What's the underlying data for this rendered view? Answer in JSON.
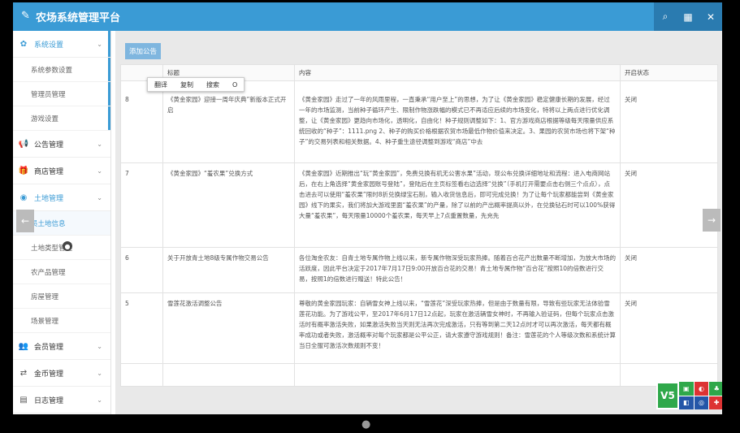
{
  "app": {
    "logo": "✎",
    "title": "农场系统管理平台"
  },
  "topbar": {
    "search_icon": "⌕",
    "grid_icon": "▦",
    "close_icon": "✕"
  },
  "sidebar": {
    "system_settings": "系统设置",
    "system_sub": [
      "系统参数设置",
      "管理员管理",
      "游戏设置"
    ],
    "announcement": "公告管理",
    "shop": "商店管理",
    "land": "土地管理",
    "land_sub": [
      "员土地信息",
      "土地类型管理",
      "农产品管理",
      "房屋管理",
      "场景管理"
    ],
    "member": "会员管理",
    "coin": "金币管理",
    "log": "日志管理"
  },
  "content": {
    "add_button": "添加公告",
    "columns": [
      "",
      "标题",
      "内容",
      "开启状态"
    ],
    "rows": [
      {
        "id": "8",
        "title": "《黄金家园》迎接一周年庆典”新版本正式开启",
        "content": "《黄金家园》走过了一年的风雨里程，一直秉承“用户至上”的思想，为了让《黄金家园》稳定健康长期的发展，经过一年的市场监测，当前种子循环产生、限制作物涨跌幅的模式已不再适应后续的市场变化，特将以上两点进行优化调整，让《黄金家园》更趋向市场化，透明化，自由化！种子规则调整如下：1、官方游戏商店根据等级每天限量供应系统回收的“种子”：1111.png 2、种子的购买价格根据农贸市场最低作物价值来决定。3、果园的农贸市场也将下架“种子”的交易列表和相关数据。4、种子重生途径调整到游戏“商店”中去",
        "status": "关闭"
      },
      {
        "id": "7",
        "title": "《黄金家园》“羞农果”兑换方式",
        "content": "《黄金家园》近期推出“玩“黄金家园”，免费兑换有机无公害水果”活动，现公布兑换详细地址和流程：进入电商网站后，在右上角选择“黄金家园账号登陆”，登陆后在主页标签看右边选择“兑换”（手机打开需要点击右侧三个点点），点击进去可以使用“羞农果”限时8折兑换绿宝石制，输入收货信息后，即可完成兑换！为了让每个玩家都能尝到《黄金家园》线下的果实，我们将加大游戏里面“羞农果”的产量，除了以前的产出概率提高以外，在兑换钻石时可以100%获得大量“羞农果”，每天限量10000个羞农果，每天早上7点重置数量，先充先",
        "status": "关闭"
      },
      {
        "id": "6",
        "title": "关于开放青土地8级专属作物交易公告",
        "content": "各位淘金农友：自青土地专属作物上线以来，新专属作物深受玩家热捧。随着百合花产出数量不断增加，为放大市场的活跃度，因此平台决定于2017年7月17日9:00开放百合花的交易！青土地专属作物“百合花”按照10的倍数进行交易，按照1的倍数进行赠送！特此公告！",
        "status": "关闭"
      },
      {
        "id": "5",
        "title": "雪莲花激活调整公告",
        "content": "尊敬的黄金家园玩家：自辆雪女神上线以来，“雪莲花”深受玩家热捧，但是由于数量有限，导致有些玩家无法体验雪莲花功能。为了游戏公平，至2017年6月17日12点起，玩家在激活辆雪女神时，不再输入验证码，但每个玩家点击激活时有概率激活失败，如果激活失败当天则无法再次完成激活，只有等到第二天12点时才可以再次激活，每天都有概率成功或者失败，激活概率对每个玩家都是公平公正，请大家遵守游戏规则！备注：雪莲花的个人等级次数和系统计算当日全服可激活次数规则不变！",
        "status": "关闭"
      }
    ]
  },
  "context_menu": [
    "翻译",
    "复制",
    "搜索",
    "O"
  ],
  "badges": {
    "v_label": "V5"
  }
}
